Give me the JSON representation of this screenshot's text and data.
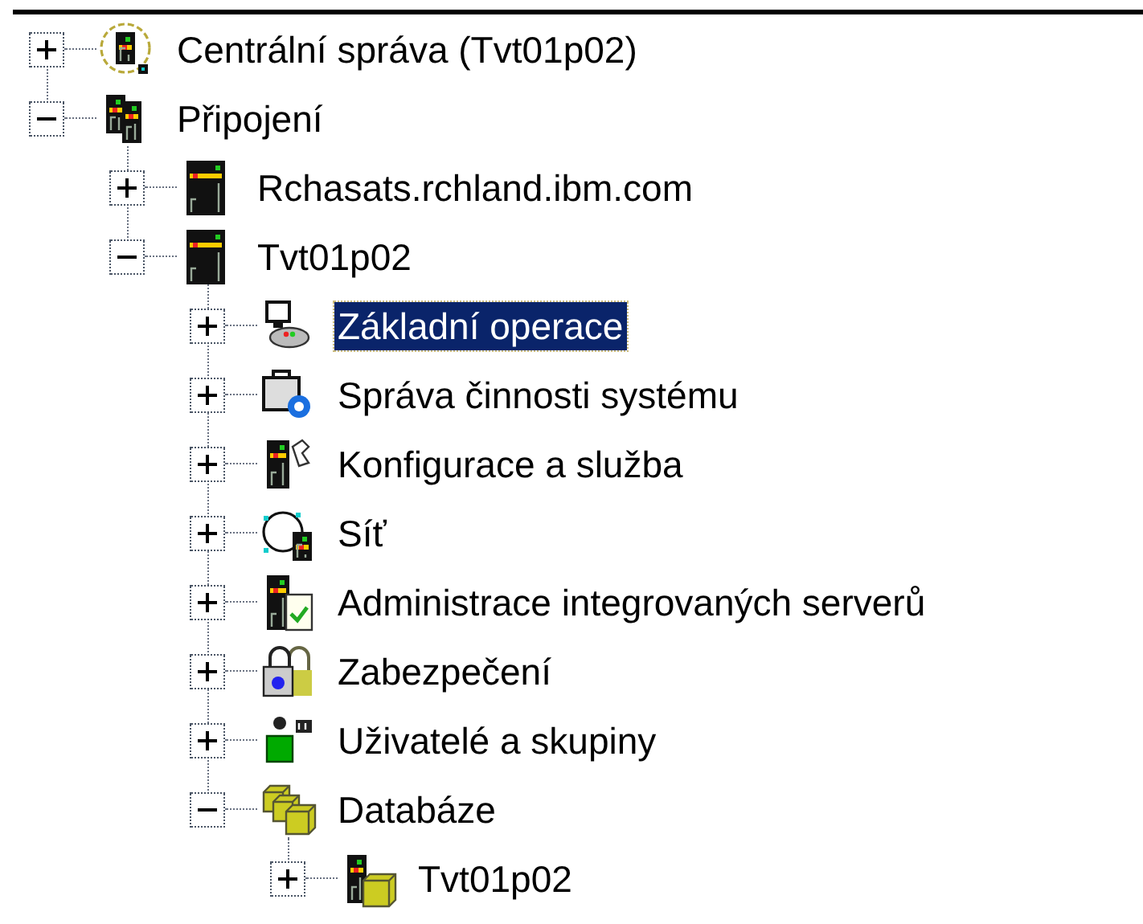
{
  "tree": {
    "items": [
      {
        "label": "Centrální správa (Tvt01p02)",
        "kind": "central",
        "expanded": false,
        "selected": false
      },
      {
        "label": "Připojení",
        "kind": "servers",
        "expanded": true,
        "selected": false,
        "children": [
          {
            "label": "Rchasats.rchland.ibm.com",
            "kind": "server",
            "expanded": false,
            "selected": false
          },
          {
            "label": "Tvt01p02",
            "kind": "server",
            "expanded": true,
            "selected": false,
            "children": [
              {
                "label": "Základní operace",
                "kind": "operations",
                "expanded": false,
                "selected": true
              },
              {
                "label": "Správa činnosti systému",
                "kind": "work",
                "expanded": false,
                "selected": false
              },
              {
                "label": "Konfigurace a služba",
                "kind": "config",
                "expanded": false,
                "selected": false
              },
              {
                "label": "Síť",
                "kind": "network",
                "expanded": false,
                "selected": false
              },
              {
                "label": "Administrace integrovaných serverů",
                "kind": "integrated",
                "expanded": false,
                "selected": false
              },
              {
                "label": "Zabezpečení",
                "kind": "security",
                "expanded": false,
                "selected": false
              },
              {
                "label": "Uživatelé a skupiny",
                "kind": "users",
                "expanded": false,
                "selected": false
              },
              {
                "label": "Databáze",
                "kind": "databases",
                "expanded": true,
                "selected": false,
                "children": [
                  {
                    "label": "Tvt01p02",
                    "kind": "dbserver",
                    "expanded": false,
                    "selected": false
                  }
                ]
              }
            ]
          }
        ]
      }
    ]
  }
}
